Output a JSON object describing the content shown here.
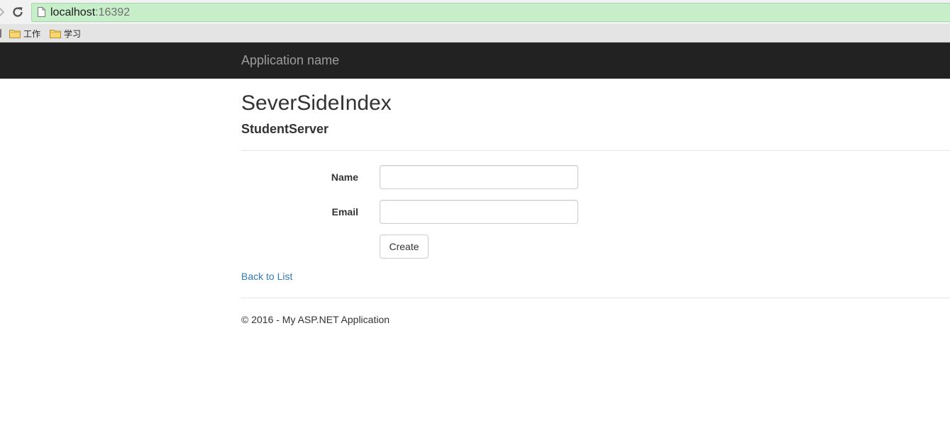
{
  "browser": {
    "url_host": "localhost",
    "url_port": ":16392",
    "bookmarks": [
      {
        "label": "工作",
        "icon": "folder-icon"
      },
      {
        "label": "学习",
        "icon": "folder-icon"
      }
    ]
  },
  "navbar": {
    "brand": "Application name"
  },
  "main": {
    "title": "SeverSideIndex",
    "subtitle": "StudentServer",
    "form": {
      "name_label": "Name",
      "name_value": "",
      "email_label": "Email",
      "email_value": "",
      "create_label": "Create"
    },
    "back_link": "Back to List"
  },
  "footer": {
    "text": "© 2016 - My ASP.NET Application"
  },
  "colors": {
    "navbar_bg": "#222222",
    "brand_text": "#9d9d9d",
    "link": "#337ab7",
    "omnibox_secure": "#c6eec9"
  }
}
